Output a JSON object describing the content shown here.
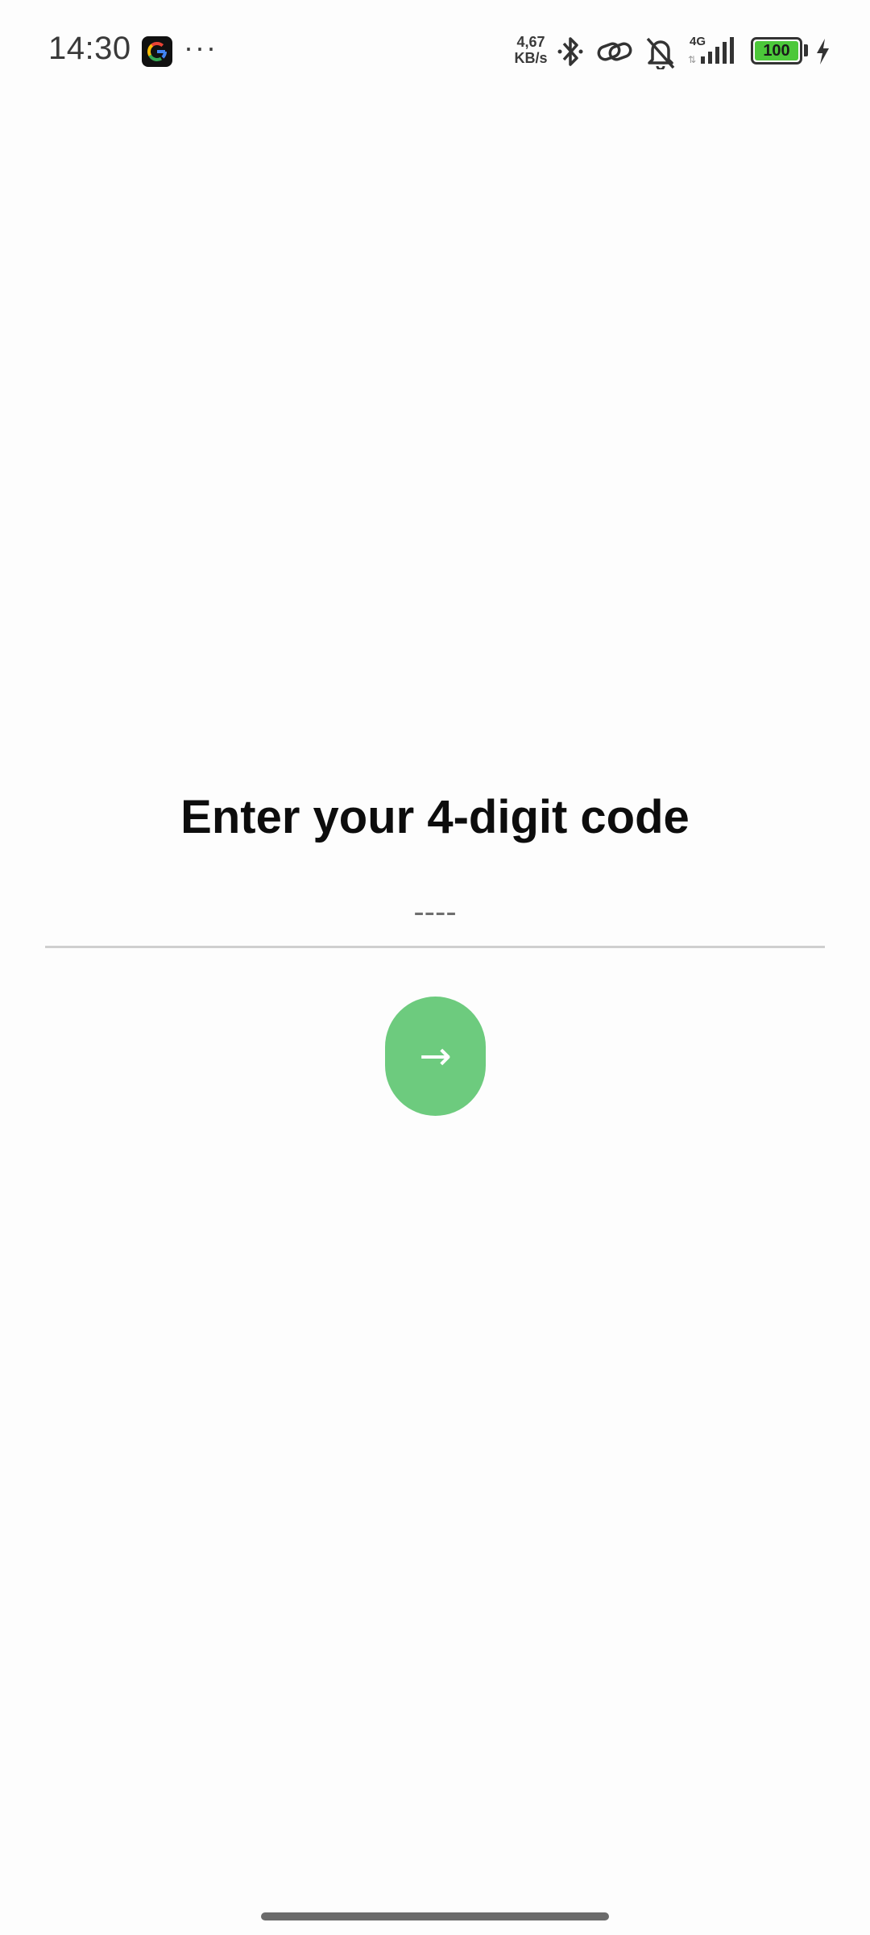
{
  "status_bar": {
    "time": "14:30",
    "net_speed_value": "4,67",
    "net_speed_unit": "KB/s",
    "network_type": "4G",
    "battery_level": "100",
    "icons": [
      "google-app-icon",
      "more-dots-icon",
      "bluetooth-icon",
      "link-icon",
      "bell-off-icon",
      "signal-icon",
      "battery-icon",
      "charging-icon"
    ]
  },
  "main": {
    "title": "Enter your 4-digit code",
    "code_input": {
      "value": "",
      "placeholder": "----"
    },
    "next_button_label": "→"
  },
  "colors": {
    "accent_green": "#6dcb7e",
    "battery_green": "#4cc83a",
    "divider": "#cfcfcf"
  }
}
